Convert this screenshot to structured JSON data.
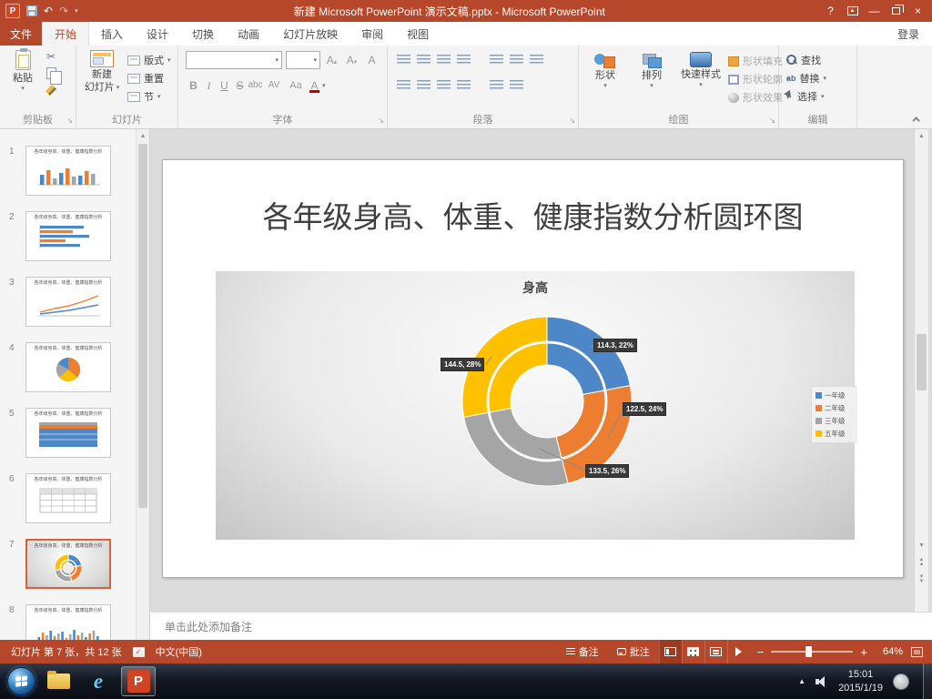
{
  "titlebar": {
    "title": "新建 Microsoft PowerPoint 演示文稿.pptx - Microsoft PowerPoint"
  },
  "ribbon": {
    "file_tab": "文件",
    "tabs": [
      "开始",
      "插入",
      "设计",
      "切换",
      "动画",
      "幻灯片放映",
      "审阅",
      "视图"
    ],
    "active_tab": "开始",
    "sign_in": "登录",
    "groups": {
      "clipboard": {
        "label": "剪贴板",
        "paste": "粘贴"
      },
      "slides": {
        "label": "幻灯片",
        "new_slide_line1": "新建",
        "new_slide_line2": "幻灯片",
        "layout": "版式",
        "reset": "重置",
        "section": "节"
      },
      "font": {
        "label": "字体",
        "bold": "B",
        "italic": "I",
        "underline": "U",
        "strike": "S",
        "abc": "abc",
        "spacing": "AV",
        "case": "Aa",
        "color": "A"
      },
      "paragraph": {
        "label": "段落"
      },
      "drawing": {
        "label": "绘图",
        "shapes": "形状",
        "arrange": "排列",
        "quick_styles": "快速样式",
        "fill": "形状填充",
        "outline": "形状轮廓",
        "effects": "形状效果"
      },
      "editing": {
        "label": "编辑",
        "find": "查找",
        "replace": "替换",
        "select": "选择"
      }
    }
  },
  "slides_panel": {
    "selected": 7,
    "slides": [
      {
        "num": "1",
        "kind": "column",
        "title": "各年级身高、体重、健康指数分析"
      },
      {
        "num": "2",
        "kind": "barh",
        "title": "各年级身高、体重、健康指数分析"
      },
      {
        "num": "3",
        "kind": "line",
        "title": "各年级身高、体重、健康指数分析"
      },
      {
        "num": "4",
        "kind": "pie",
        "title": "各年级身高、体重、健康指数分析"
      },
      {
        "num": "5",
        "kind": "area",
        "title": "各年级身高、体重、健康指数分析"
      },
      {
        "num": "6",
        "kind": "table",
        "title": "各年级身高、体重、健康指数分析"
      },
      {
        "num": "7",
        "kind": "donut",
        "title": "各年级身高、体重、健康指数分析"
      },
      {
        "num": "8",
        "kind": "dense",
        "title": "各年级身高、体重、健康指数分析"
      }
    ]
  },
  "slide": {
    "title": "各年级身高、体重、健康指数分析圆环图"
  },
  "chart_data": {
    "type": "doughnut",
    "title": "身高",
    "categories": [
      "一年级",
      "二年级",
      "三年级",
      "五年级"
    ],
    "values": [
      114.3,
      122.5,
      133.5,
      144.5
    ],
    "percents": [
      22,
      24,
      26,
      28
    ],
    "labels": [
      "114.3, 22%",
      "122.5, 24%",
      "133.5, 26%",
      "144.5, 28%"
    ],
    "colors": [
      "#4E87C7",
      "#ED7D31",
      "#A5A5A5",
      "#FFC000"
    ],
    "rings": 2,
    "legend_position": "right"
  },
  "notes": {
    "placeholder": "单击此处添加备注"
  },
  "status_bar": {
    "slide_info": "幻灯片 第 7 张，共 12 张",
    "language": "中文(中国)",
    "notes": "备注",
    "comments": "批注",
    "zoom": "64%"
  },
  "taskbar": {
    "time": "15:01",
    "date": "2015/1/19"
  },
  "icons": {
    "scissors": "✂",
    "undo": "↶",
    "redo": "↷",
    "dropdown": "▾",
    "launcher": "↘",
    "check": "✓",
    "help": "?",
    "minimize": "—",
    "close": "×",
    "up": "▲",
    "down": "▼",
    "replace_glyph": "ab"
  }
}
